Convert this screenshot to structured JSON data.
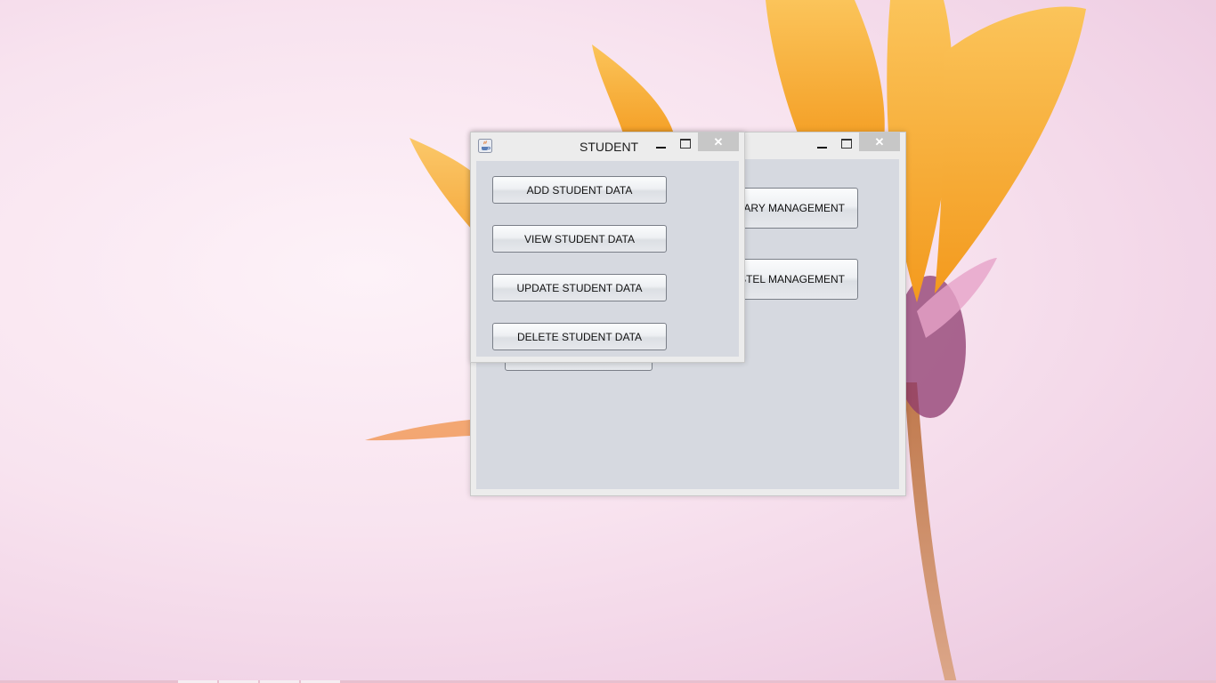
{
  "main_window": {
    "buttons": {
      "library": "RARY MANAGEMENT",
      "hostel": "STEL MANAGEMENT"
    },
    "close_glyph": "✕"
  },
  "student_window": {
    "title": "STUDENT",
    "close_glyph": "✕",
    "buttons": {
      "add": "ADD STUDENT DATA",
      "view": "VIEW STUDENT DATA",
      "update": "UPDATE STUDENT DATA",
      "delete": "DELETE STUDENT DATA"
    }
  },
  "icons": {
    "app": "java-cup-icon",
    "minimize": "minimize-icon",
    "maximize": "maximize-icon",
    "close": "close-icon"
  },
  "colors": {
    "window_client": "#d6d9e0",
    "close_button": "#c7c7c7",
    "petal": "#f6a623"
  }
}
